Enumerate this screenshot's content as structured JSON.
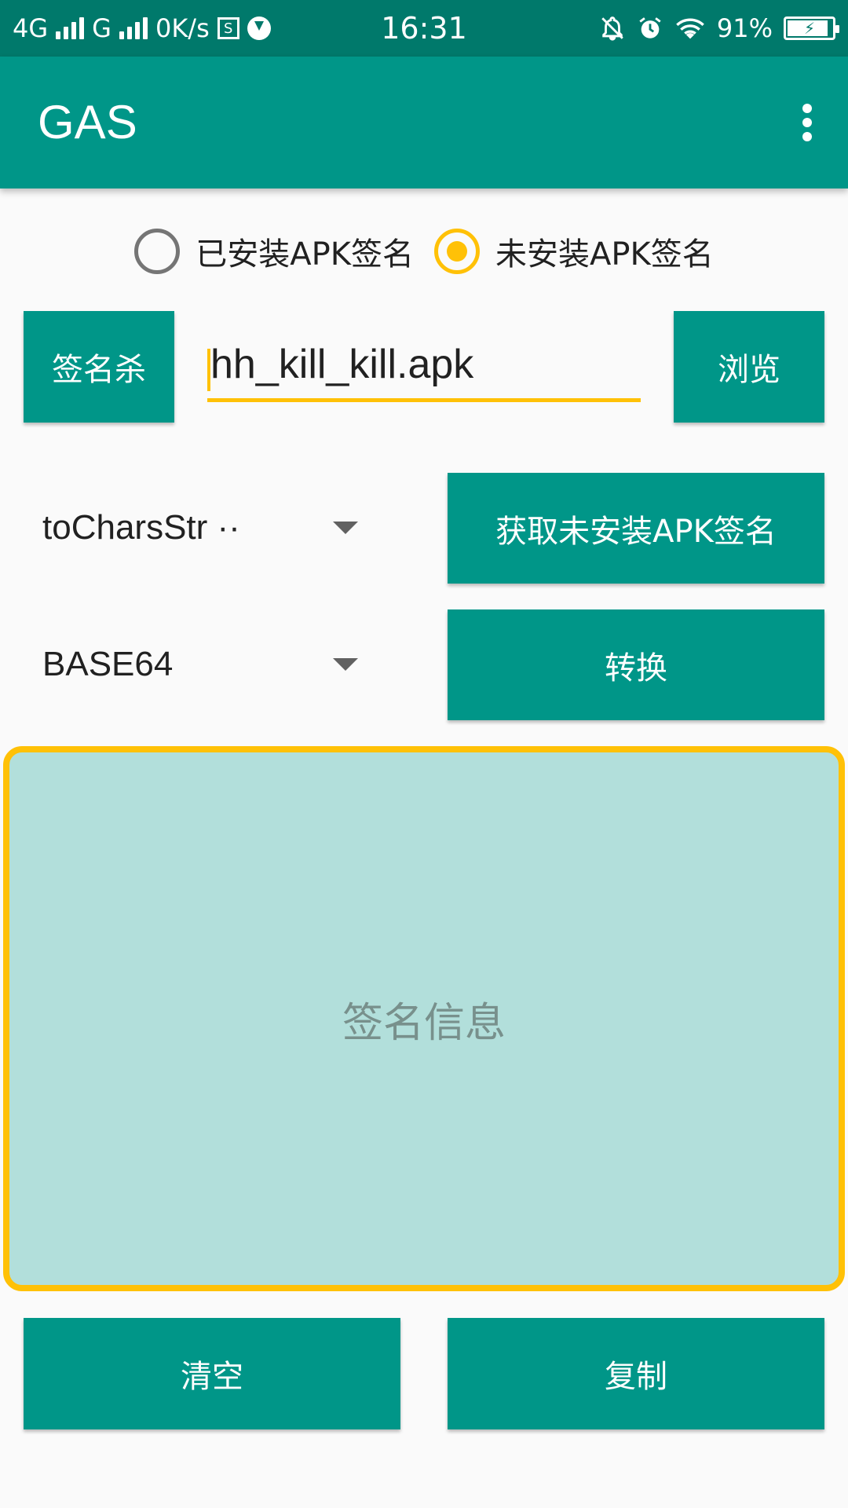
{
  "status_bar": {
    "network_1": "4G",
    "network_2": "G",
    "speed": "0K/s",
    "s_badge": "S",
    "time": "16:31",
    "battery": "91%",
    "battery_level": 0.91,
    "icons": [
      "signal-icon",
      "sim-s-icon",
      "download-icon",
      "mute-bell-icon",
      "alarm-icon",
      "wifi-icon",
      "battery-charging-icon"
    ]
  },
  "app_bar": {
    "title": "GAS",
    "overflow_icon": "more-vert-icon"
  },
  "radio_group": {
    "options": [
      {
        "label": "已安装APK签名",
        "checked": false
      },
      {
        "label": "未安装APK签名",
        "checked": true
      }
    ]
  },
  "file_row": {
    "left_button": "签名杀",
    "file_value": "hh_kill_kill.apk",
    "browse_button": "浏览"
  },
  "spinner_1": {
    "value": "toCharsStr ··",
    "action_button": "获取未安装APK签名"
  },
  "spinner_2": {
    "value": "BASE64",
    "action_button": "转换"
  },
  "info_box": {
    "placeholder": "签名信息"
  },
  "bottom_buttons": {
    "clear": "清空",
    "copy": "复制"
  },
  "colors": {
    "primary": "#009688",
    "primary_dark": "#00796b",
    "accent": "#ffc107",
    "info_bg": "#b2dfdb"
  }
}
